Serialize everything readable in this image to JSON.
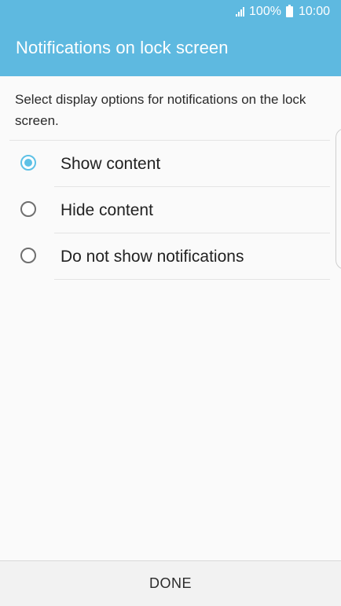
{
  "status_bar": {
    "signal_icon": "signal-bars-icon",
    "battery_percent": "100%",
    "battery_icon": "battery-icon",
    "time": "10:00"
  },
  "header": {
    "title": "Notifications on lock screen",
    "background_color": "#5eb9e0"
  },
  "main": {
    "description": "Select display options for notifications on the lock screen.",
    "options": [
      {
        "label": "Show content",
        "selected": true
      },
      {
        "label": "Hide content",
        "selected": false
      },
      {
        "label": "Do not show notifications",
        "selected": false
      }
    ],
    "accent_color": "#5ec1e6"
  },
  "footer": {
    "done_label": "DONE"
  }
}
